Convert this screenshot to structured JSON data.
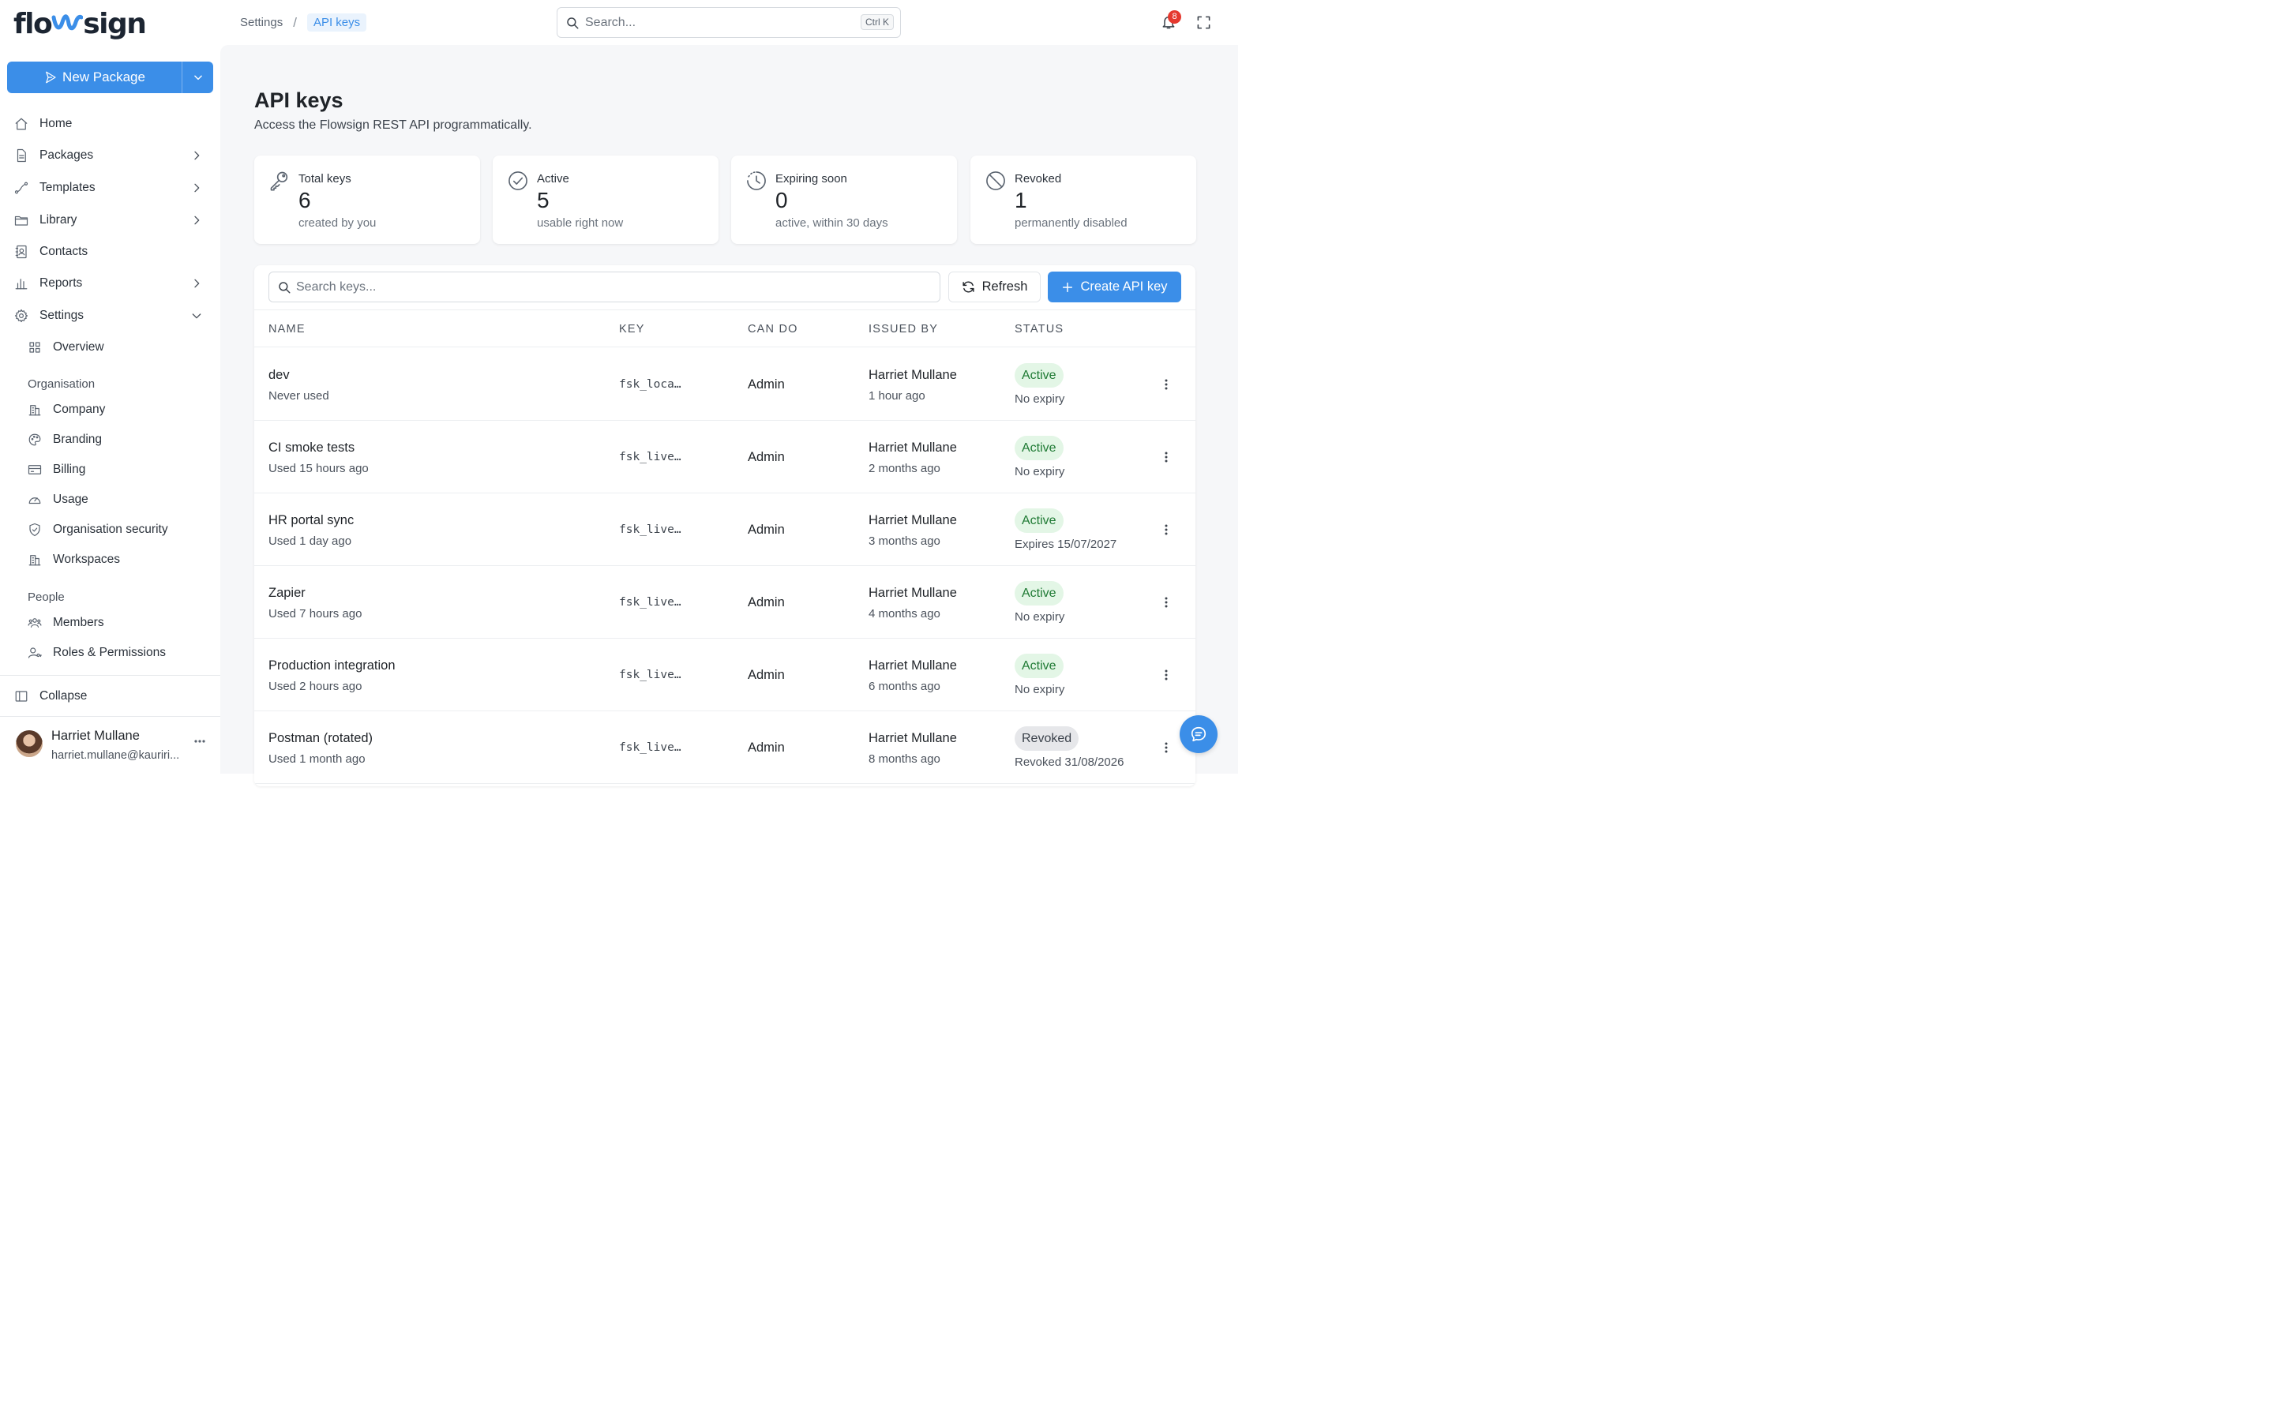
{
  "brand": {
    "logo_pre": "flo",
    "logo_post": "sign"
  },
  "sidebar": {
    "new_package_label": "New Package",
    "items": [
      {
        "label": "Home",
        "icon": "home-icon"
      },
      {
        "label": "Packages",
        "icon": "document-icon"
      },
      {
        "label": "Templates",
        "icon": "route-icon"
      },
      {
        "label": "Library",
        "icon": "folder-icon"
      },
      {
        "label": "Contacts",
        "icon": "contact-book-icon"
      },
      {
        "label": "Reports",
        "icon": "bar-chart-icon"
      },
      {
        "label": "Settings",
        "icon": "gear-icon"
      }
    ],
    "settings_overview": "Overview",
    "section_organisation": "Organisation",
    "organisation_items": [
      "Company",
      "Branding",
      "Billing",
      "Usage",
      "Organisation security",
      "Workspaces"
    ],
    "section_people": "People",
    "people_items": [
      "Members",
      "Roles & Permissions"
    ],
    "collapse_label": "Collapse",
    "user": {
      "name": "Harriet Mullane",
      "email": "harriet.mullane@kauriri..."
    }
  },
  "topbar": {
    "breadcrumb_parent": "Settings",
    "breadcrumb_sep": "/",
    "breadcrumb_current": "API keys",
    "search_placeholder": "Search...",
    "search_shortcut": "Ctrl K",
    "notification_count": "8"
  },
  "page": {
    "title": "API keys",
    "subtitle": "Access the Flowsign REST API programmatically."
  },
  "stats": [
    {
      "label": "Total keys",
      "value": "6",
      "sub": "created by you",
      "icon": "key-icon"
    },
    {
      "label": "Active",
      "value": "5",
      "sub": "usable right now",
      "icon": "check-circle-icon"
    },
    {
      "label": "Expiring soon",
      "value": "0",
      "sub": "active, within 30 days",
      "icon": "clock-icon"
    },
    {
      "label": "Revoked",
      "value": "1",
      "sub": "permanently disabled",
      "icon": "ban-icon"
    }
  ],
  "toolbar": {
    "search_placeholder": "Search keys...",
    "refresh_label": "Refresh",
    "create_label": "Create API key"
  },
  "table": {
    "columns": [
      "NAME",
      "KEY",
      "CAN DO",
      "ISSUED BY",
      "STATUS"
    ],
    "rows": [
      {
        "name": "dev",
        "used": "Never used",
        "key": "fsk_loca…",
        "can_do": "Admin",
        "issuer": "Harriet Mullane",
        "issued": "1 hour ago",
        "status": "Active",
        "expiry": "No expiry"
      },
      {
        "name": "CI smoke tests",
        "used": "Used 15 hours ago",
        "key": "fsk_live…",
        "can_do": "Admin",
        "issuer": "Harriet Mullane",
        "issued": "2 months ago",
        "status": "Active",
        "expiry": "No expiry"
      },
      {
        "name": "HR portal sync",
        "used": "Used 1 day ago",
        "key": "fsk_live…",
        "can_do": "Admin",
        "issuer": "Harriet Mullane",
        "issued": "3 months ago",
        "status": "Active",
        "expiry": "Expires 15/07/2027"
      },
      {
        "name": "Zapier",
        "used": "Used 7 hours ago",
        "key": "fsk_live…",
        "can_do": "Admin",
        "issuer": "Harriet Mullane",
        "issued": "4 months ago",
        "status": "Active",
        "expiry": "No expiry"
      },
      {
        "name": "Production integration",
        "used": "Used 2 hours ago",
        "key": "fsk_live…",
        "can_do": "Admin",
        "issuer": "Harriet Mullane",
        "issued": "6 months ago",
        "status": "Active",
        "expiry": "No expiry"
      },
      {
        "name": "Postman (rotated)",
        "used": "Used 1 month ago",
        "key": "fsk_live…",
        "can_do": "Admin",
        "issuer": "Harriet Mullane",
        "issued": "8 months ago",
        "status": "Revoked",
        "expiry": "Revoked 31/08/2026"
      }
    ]
  },
  "colors": {
    "accent": "#3b8ee8",
    "active_bg": "#e3f6e6",
    "active_fg": "#1f7a34",
    "revoked_bg": "#e6e7ea",
    "badge_red": "#e5392f"
  }
}
